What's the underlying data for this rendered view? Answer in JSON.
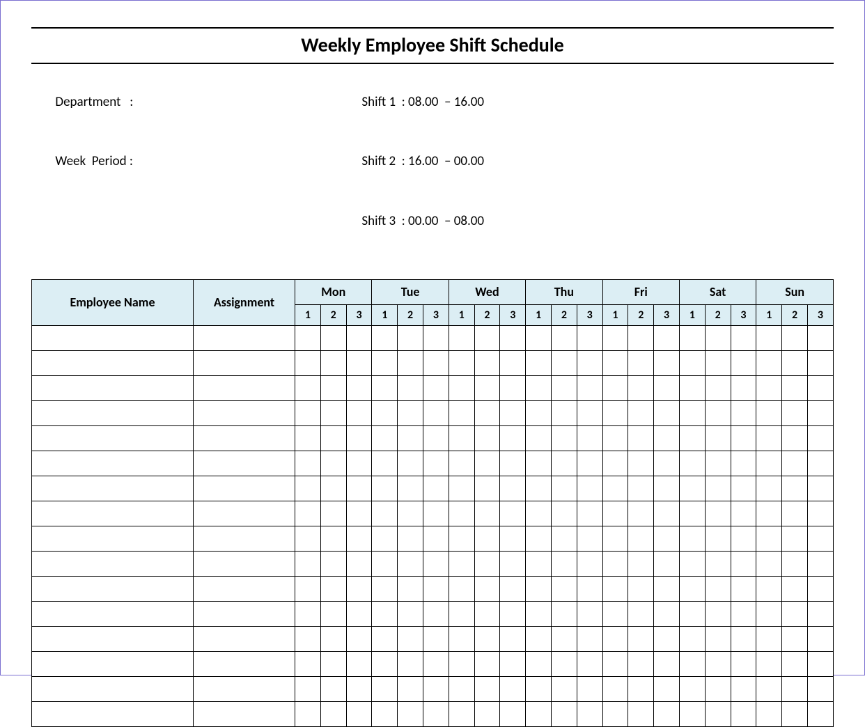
{
  "title": "Weekly Employee Shift Schedule",
  "meta": {
    "department_label": "Department",
    "department_sep": "   :",
    "week_period_label": "Week  Period",
    "week_period_sep": " :",
    "shifts": [
      {
        "label": "Shift 1",
        "sep": "  :",
        "time": " 08.00  – 16.00"
      },
      {
        "label": "Shift 2",
        "sep": "  :",
        "time": " 16.00  – 00.00"
      },
      {
        "label": "Shift 3",
        "sep": "  :",
        "time": " 00.00  – 08.00"
      }
    ]
  },
  "table": {
    "headers": {
      "employee_name": "Employee Name",
      "assignment": "Assignment",
      "days": [
        "Mon",
        "Tue",
        "Wed",
        "Thu",
        "Fri",
        "Sat",
        "Sun"
      ],
      "sub_shifts": [
        "1",
        "2",
        "3"
      ]
    },
    "row_count": 16
  }
}
